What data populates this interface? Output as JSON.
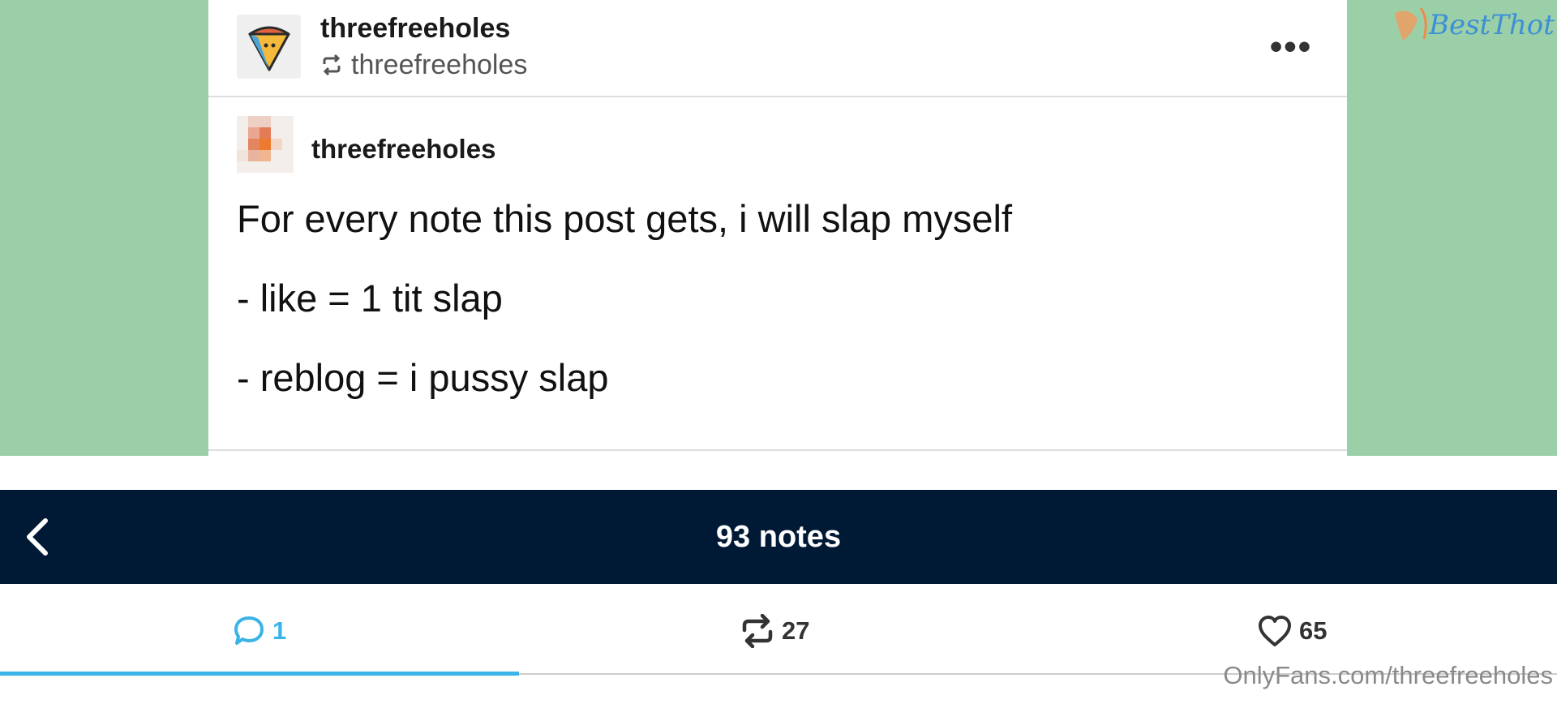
{
  "post": {
    "reblogger_name": "threefreeholes",
    "reblogged_from": "threefreeholes",
    "more_label": "•••",
    "trail_name": "threefreeholes",
    "body_lines": [
      "For every note this post gets, i will slap myself",
      "- like = 1 tit slap",
      "- reblog = i pussy slap"
    ]
  },
  "notes_bar": {
    "title": "93 notes"
  },
  "tabs": {
    "replies_count": "1",
    "reblogs_count": "27",
    "likes_count": "65",
    "active": "replies"
  },
  "watermarks": {
    "top_logo_text": "BestThot",
    "bottom_text": "OnlyFans.com/threefreeholes"
  },
  "colors": {
    "page_background_green": "#9bcfa8",
    "notes_bar_navy": "#001935",
    "accent_blue": "#3ab3e6",
    "avatar_orange": "#e0633f",
    "avatar_yellow": "#f5b93c",
    "avatar_blue": "#4aa3d8"
  },
  "icons": {
    "avatar": "pizza-cone-avatar-icon",
    "reblog": "reblog-icon",
    "more": "more-dots-icon",
    "back": "chevron-left-icon",
    "replies": "speech-bubble-icon",
    "reblogs": "reblog-arrows-icon",
    "likes": "heart-icon"
  }
}
